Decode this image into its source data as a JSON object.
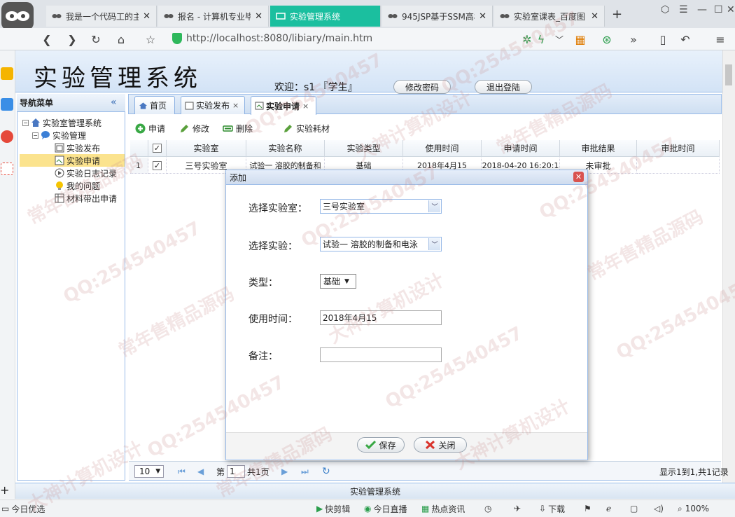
{
  "browser": {
    "tabs": [
      {
        "label": "我是一个代码工的主",
        "active": false
      },
      {
        "label": "报名 - 计算机专业毕",
        "active": false
      },
      {
        "label": "实验管理系统",
        "active": true
      },
      {
        "label": "945JSP基于SSM高校",
        "active": false
      },
      {
        "label": "实验室课表_百度图",
        "active": false
      }
    ],
    "url": "http://localhost:8080/libiary/main.htm"
  },
  "app": {
    "title": "实验管理系统",
    "welcome": "欢迎：s1 『学生』",
    "change_password": "修改密码",
    "logout": "退出登陆",
    "footer": "实验管理系统"
  },
  "nav": {
    "title": "导航菜单",
    "root": "实验室管理系统",
    "group": "实验管理",
    "items": [
      "实验发布",
      "实验申请",
      "实验日志记录",
      "我的问题",
      "材料带出申请"
    ]
  },
  "content_tabs": [
    {
      "label": "首页",
      "closable": false
    },
    {
      "label": "实验发布",
      "closable": true
    },
    {
      "label": "实验申请",
      "closable": true,
      "selected": true
    }
  ],
  "toolbar": {
    "apply": "申请",
    "edit": "修改",
    "delete": "删除",
    "consumables": "实验耗材"
  },
  "grid": {
    "columns": [
      "实验室",
      "实验名称",
      "实验类型",
      "使用时间",
      "申请时间",
      "审批结果",
      "审批时间"
    ],
    "rows": [
      {
        "num": "1",
        "cells": [
          "三号实验室",
          "试验一 溶胶的制备和",
          "基础",
          "2018年4月15",
          "2018-04-20 16:20:1",
          "未审批",
          ""
        ]
      }
    ]
  },
  "pager": {
    "page_size": "10",
    "page_prefix": "第",
    "page": "1",
    "page_suffix": "共1页",
    "summary": "显示1到1,共1记录"
  },
  "dialog": {
    "title": "添加",
    "fields": [
      {
        "label": "选择实验室：",
        "value": "三号实验室"
      },
      {
        "label": "选择实验：",
        "value": "试验一 溶胶的制备和电泳"
      },
      {
        "label": "类型：",
        "value": "基础"
      },
      {
        "label": "使用时间：",
        "value": "2018年4月15"
      },
      {
        "label": "备注：",
        "value": ""
      }
    ],
    "save": "保存",
    "close": "关闭"
  },
  "status": {
    "left": "今日优选",
    "items": [
      "快剪辑",
      "今日直播",
      "热点资讯",
      "下载"
    ],
    "zoom": "100%"
  },
  "watermarks": [
    "QQ:254540457",
    "常年售精品源码",
    "大神计算机设计"
  ],
  "colors": {
    "accent_tab": "#1bbf9f",
    "panel_border": "#99bbe8"
  }
}
